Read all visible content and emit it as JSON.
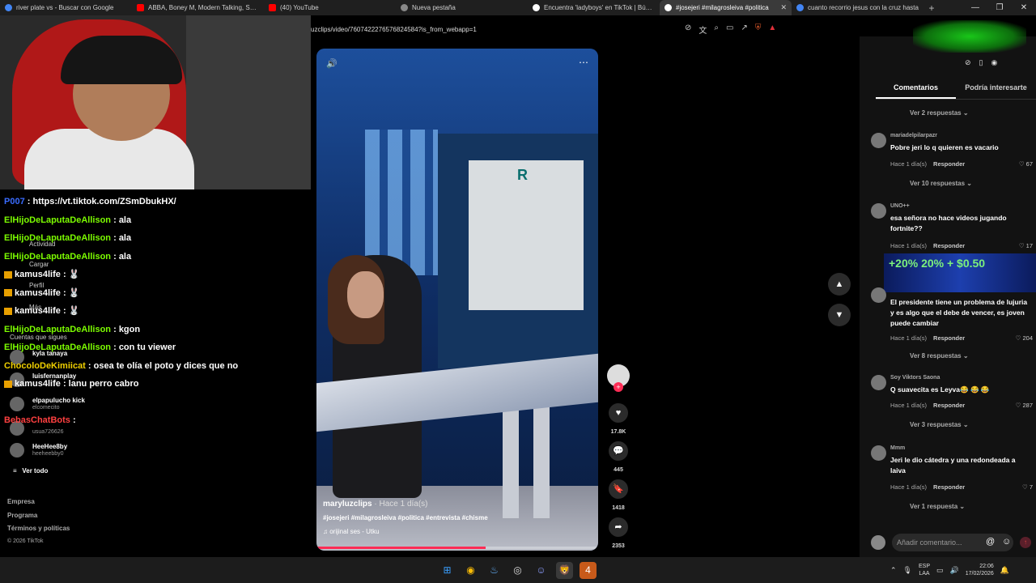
{
  "browser": {
    "tabs": [
      {
        "label": "river plate vs - Buscar con Google",
        "color": "#4285f4"
      },
      {
        "label": "ABBA, Boney M, Modern Talking, Sandra",
        "color": "#ff0000"
      },
      {
        "label": "(40) YouTube",
        "color": "#ff0000"
      },
      {
        "label": "Nueva pestaña",
        "color": "#888888"
      },
      {
        "label": "Encuentra 'ladyboys' en TikTok | Búsqueda",
        "color": "#ffffff"
      },
      {
        "label": "#josejeri #milagrosleiva #politica",
        "color": "#ffffff"
      },
      {
        "label": "cuanto recorrio jesus con la cruz hasta",
        "color": "#4285f4"
      }
    ],
    "close_glyph": "✕",
    "new_tab_glyph": "+",
    "window_controls": [
      "—",
      "❐",
      "✕"
    ],
    "url": "uzclips/video/7607422276576824584?is_from_webapp=1"
  },
  "chat": [
    {
      "user": "P007",
      "user_color": "#3a6cff",
      "msg": ": https://vt.tiktok.com/ZSmDbukHX/",
      "badge": false
    },
    {
      "user": "ElHijoDeLaputaDeAllison",
      "user_color": "#7CFC00",
      "msg": ": ala",
      "badge": false
    },
    {
      "user": "ElHijoDeLaputaDeAllison",
      "user_color": "#7CFC00",
      "msg": ": ala",
      "badge": false
    },
    {
      "user": "ElHijoDeLaputaDeAllison",
      "user_color": "#7CFC00",
      "msg": ": ala",
      "badge": false
    },
    {
      "user": "kamus4life",
      "user_color": "#ffffff",
      "msg": ":",
      "badge": true
    },
    {
      "user": "kamus4life",
      "user_color": "#ffffff",
      "msg": ":",
      "badge": true
    },
    {
      "user": "kamus4life",
      "user_color": "#ffffff",
      "msg": ":",
      "badge": true
    },
    {
      "user": "ElHijoDeLaputaDeAllison",
      "user_color": "#7CFC00",
      "msg": ": kgon",
      "badge": false
    },
    {
      "user": "ElHijoDeLaputaDeAllison",
      "user_color": "#7CFC00",
      "msg": ": con tu viewer",
      "badge": false
    },
    {
      "user": "ChocoloDeKimiicat",
      "user_color": "#f0d000",
      "msg": ": osea te olía el poto y dices que no",
      "badge": false
    },
    {
      "user": "kamus4life",
      "user_color": "#ffffff",
      "msg": ": lanu perro cabro",
      "badge": true
    },
    {
      "user": "",
      "user_color": "#ff3030",
      "msg": "",
      "badge": false
    },
    {
      "user": "BebasChatBots",
      "user_color": "#ff4040",
      "msg": ":",
      "badge": false
    }
  ],
  "tiktok_side": {
    "actividad": "Actividad",
    "cargar": "Cargar",
    "perfil": "Perfil",
    "mas": "Más",
    "cuentas": "Cuentas que sigues",
    "suggested": [
      {
        "name": "kyla tanaya",
        "handle": ""
      },
      {
        "name": "luisfernanplay",
        "handle": ""
      },
      {
        "name": "elpapulucho kick",
        "handle": "elcomecito"
      },
      {
        "name": "",
        "handle": "usua726626"
      },
      {
        "name": "HeeHee8by",
        "handle": "heeheebby0"
      }
    ],
    "see_all": "Ver todo",
    "footer": [
      "Empresa",
      "Programa",
      "Términos y políticas"
    ],
    "copyright": "© 2026 TikTok"
  },
  "video": {
    "doc_letter": "R",
    "username": "maryluzclips",
    "time": "· Hace 1 día(s)",
    "tags": "#josejeri #milagrosleiva #politica #entrevista #chisme",
    "sound": "♫ orijinal ses - Utku",
    "progress": 0.6
  },
  "actions": {
    "likes": "17.8K",
    "comments": "445",
    "saves": "1418",
    "shares": "2353"
  },
  "right_panel": {
    "tab_comments": "Comentarios",
    "tab_interest": "Podría interesarte",
    "ad_text": "+20%  20% + $0.50",
    "comments": [
      {
        "more": "Ver 2 respuestas ⌄"
      },
      {
        "user": "mariadelpilarpazr",
        "text": "Pobre jeri lo q quieren es vacario",
        "time": "Hace 1 día(s)",
        "reply": "Responder",
        "likes": "♡ 67"
      },
      {
        "more": "Ver 10 respuestas ⌄"
      },
      {
        "user": "UNO++",
        "text": "esa señora no hace videos jugando fortnite??",
        "time": "Hace 1 día(s)",
        "reply": "Responder",
        "likes": "♡ 17"
      },
      {
        "user": "",
        "text": "El presidente tiene un problema de lujuria y es algo que el debe de vencer, es joven puede cambiar",
        "time": "Hace 1 día(s)",
        "reply": "Responder",
        "likes": "♡ 204"
      },
      {
        "more": "Ver 8 respuestas ⌄"
      },
      {
        "user": "Soy Viktors Saona",
        "text": "Q suavecita es Leyva😂 😂 😂",
        "time": "Hace 1 día(s)",
        "reply": "Responder",
        "likes": "♡ 287"
      },
      {
        "more": "Ver 3 respuestas ⌄"
      },
      {
        "user": "Mmm",
        "text": "Jeri le dio cátedra y una redondeada a laiva",
        "time": "Hace 1 día(s)",
        "reply": "Responder",
        "likes": "♡ 7"
      },
      {
        "more": "Ver 1 respuesta ⌄"
      }
    ],
    "input_placeholder": "Añadir comentario...",
    "at_glyph": "@",
    "emoji_glyph": "☺",
    "send_glyph": "↑"
  },
  "taskbar": {
    "apps": [
      "start-icon",
      "chrome-icon",
      "steam-icon",
      "obs-icon",
      "discord-icon",
      "brave-icon",
      "app-icon"
    ],
    "app_glyphs": [
      "⊞",
      "◉",
      "♨",
      "◎",
      "☺",
      "🦁",
      "4"
    ],
    "lang_top": "ESP",
    "lang_bottom": "LAA",
    "time": "22:06",
    "date": "17/02/2026"
  },
  "colors": {
    "tiktok_red": "#fe2c55",
    "chat_green": "#7CFC00"
  }
}
